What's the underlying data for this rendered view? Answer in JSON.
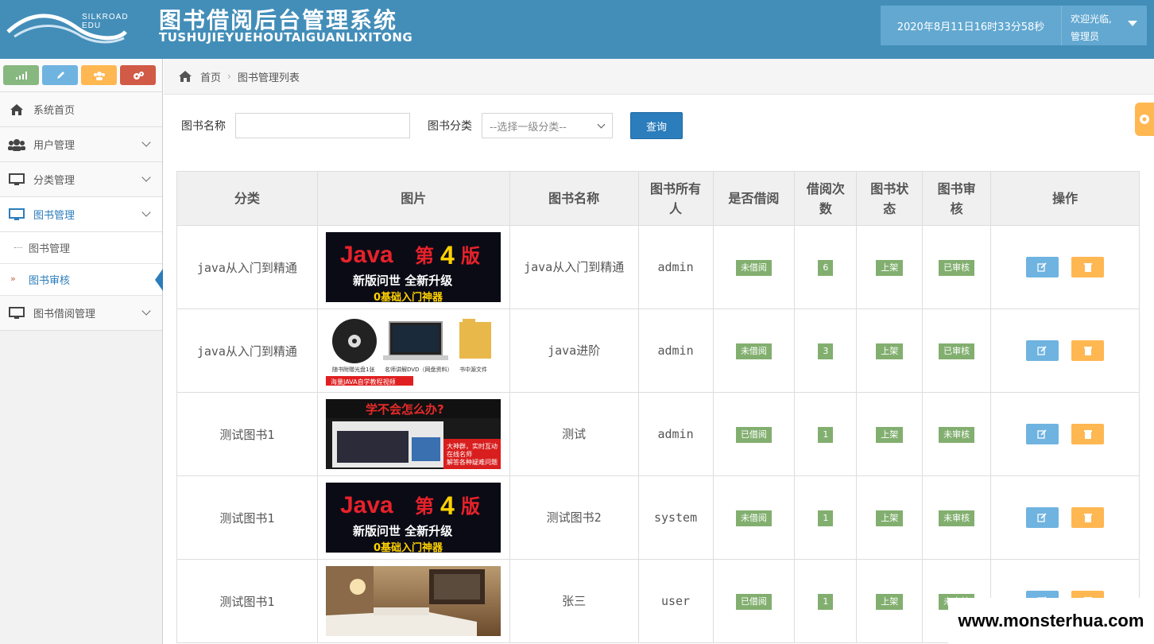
{
  "header": {
    "logo_text": "SILKROAD EDU",
    "title": "图书借阅后台管理系统",
    "subtitle": "TUSHUJIEYUEHOUTAIGUANLIXITONG",
    "datetime": "2020年8月11日16时33分58秒",
    "welcome": "欢迎光临,",
    "role": "管理员"
  },
  "sidebar": {
    "shortcut_colors": [
      "#87b87f",
      "#6fb3e0",
      "#ffb752",
      "#d15b47"
    ],
    "items": [
      {
        "label": "系统首页",
        "icon": "home-icon"
      },
      {
        "label": "用户管理",
        "icon": "users-icon"
      },
      {
        "label": "分类管理",
        "icon": "desktop-icon"
      },
      {
        "label": "图书管理",
        "icon": "desktop-icon"
      },
      {
        "label": "图书借阅管理",
        "icon": "desktop-icon"
      }
    ],
    "sub_items": [
      {
        "label": "图书管理"
      },
      {
        "label": "图书审核"
      }
    ]
  },
  "breadcrumb": {
    "home": "首页",
    "current": "图书管理列表"
  },
  "search": {
    "name_label": "图书名称",
    "name_value": "",
    "category_label": "图书分类",
    "category_selected": "--选择一级分类--",
    "button_label": "查询"
  },
  "table": {
    "headers": [
      "分类",
      "图片",
      "图书名称",
      "图书所有人",
      "是否借阅",
      "借阅次数",
      "图书状态",
      "图书审核",
      "操作"
    ],
    "rows": [
      {
        "category": "java从入门到精通",
        "image": "java-4th-edition-cover",
        "name": "java从入门到精通",
        "owner": "admin",
        "borrowed": "未借阅",
        "count": "6",
        "status": "上架",
        "review": "已审核"
      },
      {
        "category": "java从入门到精通",
        "image": "java-course-materials",
        "name": "java进阶",
        "owner": "admin",
        "borrowed": "未借阅",
        "count": "3",
        "status": "上架",
        "review": "已审核"
      },
      {
        "category": "测试图书1",
        "image": "learning-help-banner",
        "name": "测试",
        "owner": "admin",
        "borrowed": "已借阅",
        "count": "1",
        "status": "上架",
        "review": "未审核"
      },
      {
        "category": "测试图书1",
        "image": "java-4th-edition-cover",
        "name": "测试图书2",
        "owner": "system",
        "borrowed": "未借阅",
        "count": "1",
        "status": "上架",
        "review": "未审核"
      },
      {
        "category": "测试图书1",
        "image": "hotel-room-photo",
        "name": "张三",
        "owner": "user",
        "borrowed": "已借阅",
        "count": "1",
        "status": "上架",
        "review": "未审核"
      }
    ]
  },
  "images": {
    "java_line1_a": "Java",
    "java_line1_b": "第",
    "java_line1_c": "4",
    "java_line1_d": "版",
    "java_line2": "新版问世 全新升级",
    "java_line3": "0基础入门神器",
    "materials_cap1": "随书附赠光盘1张",
    "materials_cap2": "名师讲解DVD（网盘资料）",
    "materials_cap3": "书中源文件",
    "materials_footer": "海量JAVA自学教程视频",
    "help_title": "学不会怎么办?",
    "help_line1": "大神群，实时互动",
    "help_line2": "在线名师",
    "help_line3": "解答各种疑难问题"
  },
  "watermark": "www.monsterhua.com"
}
